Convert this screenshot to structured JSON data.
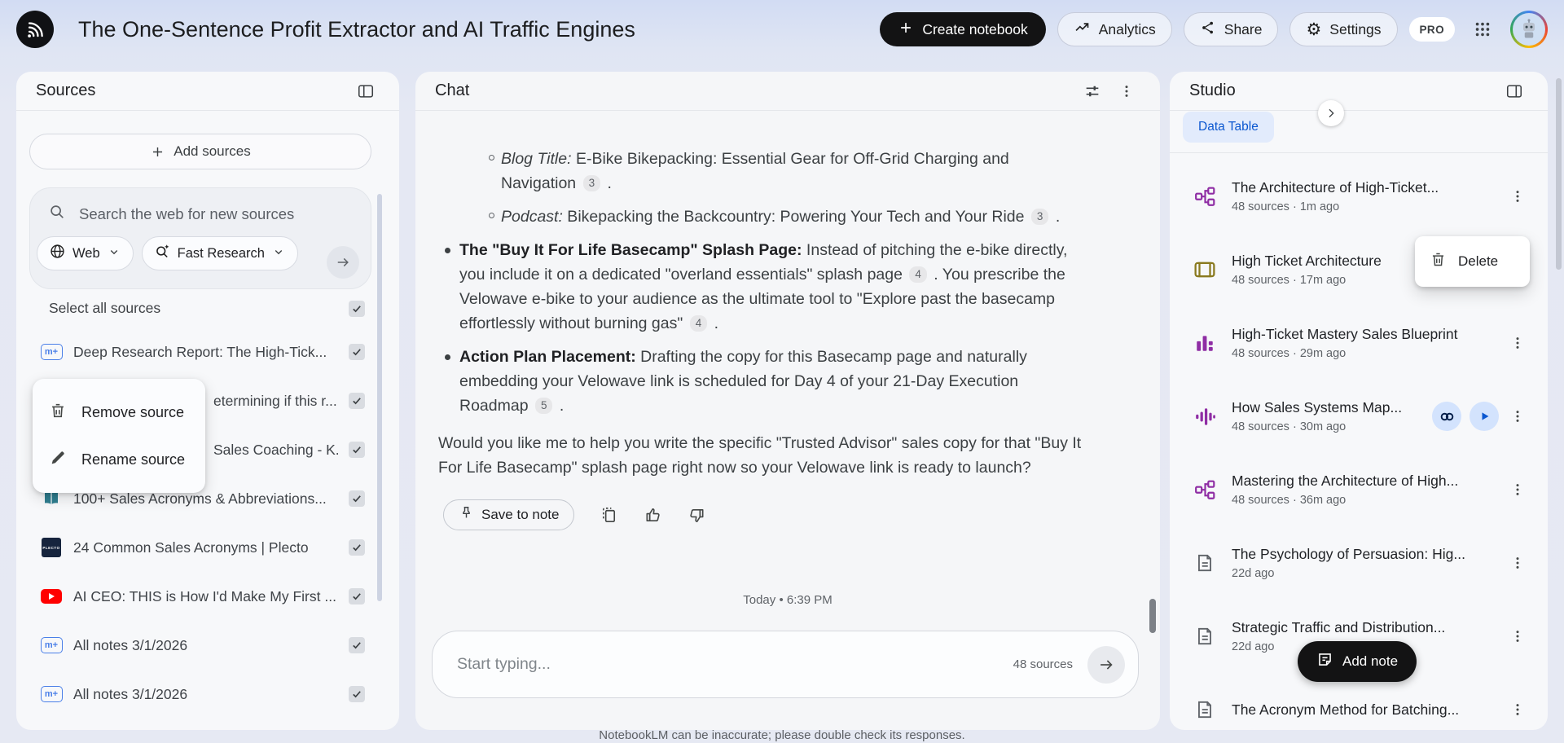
{
  "header": {
    "title": "The One-Sentence Profit Extractor and AI Traffic Engines",
    "create_label": "Create notebook",
    "analytics_label": "Analytics",
    "share_label": "Share",
    "settings_label": "Settings",
    "pro_label": "PRO"
  },
  "sources": {
    "title": "Sources",
    "add_label": "Add sources",
    "search_placeholder": "Search the web for new sources",
    "web_label": "Web",
    "fast_label": "Fast Research",
    "select_all": "Select all sources",
    "menu": {
      "remove": "Remove source",
      "rename": "Rename source"
    },
    "items": [
      {
        "icon": "markdown",
        "title": "Deep Research Report: The High-Tick...",
        "checked": true,
        "covered": false
      },
      {
        "icon": "",
        "title": "etermining if this r...",
        "checked": true,
        "covered": true
      },
      {
        "icon": "",
        "title": "Sales Coaching - K...",
        "checked": true,
        "covered": true
      },
      {
        "icon": "book",
        "title": "100+ Sales Acronyms & Abbreviations...",
        "checked": true,
        "covered": false
      },
      {
        "icon": "plecto",
        "title": "24 Common Sales Acronyms | Plecto",
        "checked": true,
        "covered": false
      },
      {
        "icon": "youtube",
        "title": "AI CEO: THIS is How I'd Make My First ...",
        "checked": true,
        "covered": false
      },
      {
        "icon": "markdown",
        "title": "All notes 3/1/2026",
        "checked": true,
        "covered": false
      },
      {
        "icon": "markdown",
        "title": "All notes 3/1/2026",
        "checked": true,
        "covered": false
      }
    ]
  },
  "chat": {
    "title": "Chat",
    "blocks": [
      {
        "type": "sub",
        "parts": [
          {
            "s": "i",
            "v": "Blog Title:"
          },
          {
            "s": "t",
            "v": " E-Bike Bikepacking: Essential Gear for Off-Grid Charging and Navigation "
          },
          {
            "s": "c",
            "v": "3"
          },
          {
            "s": "t",
            "v": " ."
          }
        ]
      },
      {
        "type": "sub",
        "parts": [
          {
            "s": "i",
            "v": "Podcast:"
          },
          {
            "s": "t",
            "v": " Bikepacking the Backcountry: Powering Your Tech and Your Ride "
          },
          {
            "s": "c",
            "v": "3"
          },
          {
            "s": "t",
            "v": " ."
          }
        ]
      },
      {
        "type": "bullet",
        "parts": [
          {
            "s": "b",
            "v": "The \"Buy It For Life Basecamp\" Splash Page:"
          },
          {
            "s": "t",
            "v": " Instead of pitching the e-bike directly, you include it on a dedicated \"overland essentials\" splash page "
          },
          {
            "s": "c",
            "v": "4"
          },
          {
            "s": "t",
            "v": " . You prescribe the Velowave e-bike to your audience as the ultimate tool to \"Explore past the basecamp effortlessly without burning gas\" "
          },
          {
            "s": "c",
            "v": "4"
          },
          {
            "s": "t",
            "v": " ."
          }
        ]
      },
      {
        "type": "bullet",
        "parts": [
          {
            "s": "b",
            "v": "Action Plan Placement:"
          },
          {
            "s": "t",
            "v": " Drafting the copy for this Basecamp page and naturally embedding your Velowave link is scheduled for Day 4 of your 21-Day Execution Roadmap "
          },
          {
            "s": "c",
            "v": "5"
          },
          {
            "s": "t",
            "v": " ."
          }
        ]
      },
      {
        "type": "para",
        "parts": [
          {
            "s": "t",
            "v": "Would you like me to help you write the specific \"Trusted Advisor\" sales copy for that \"Buy It For Life Basecamp\" splash page right now so your Velowave link is ready to launch?"
          }
        ]
      }
    ],
    "save_label": "Save to note",
    "timestamp": "Today • 6:39 PM",
    "input_placeholder": "Start typing...",
    "sources_count": "48 sources"
  },
  "studio": {
    "title": "Studio",
    "chip": "Data Table",
    "delete_label": "Delete",
    "add_note": "Add note",
    "items": [
      {
        "icon": "mindmap",
        "title": "The Architecture of High-Ticket...",
        "meta": "48 sources · 1m ago",
        "actions": [],
        "kebab": true
      },
      {
        "icon": "slides",
        "title": "High Ticket Architecture",
        "meta": "48 sources · 17m ago",
        "actions": [],
        "kebab": false
      },
      {
        "icon": "barchart",
        "title": "High-Ticket Mastery Sales Blueprint",
        "meta": "48 sources · 29m ago",
        "actions": [],
        "kebab": true
      },
      {
        "icon": "waveform",
        "title": "How Sales Systems Map...",
        "meta": "48 sources · 30m ago",
        "actions": [
          "interactive",
          "play"
        ],
        "kebab": true
      },
      {
        "icon": "mindmap",
        "title": "Mastering the Architecture of High...",
        "meta": "48 sources · 36m ago",
        "actions": [],
        "kebab": true
      },
      {
        "icon": "note",
        "title": "The Psychology of Persuasion: Hig...",
        "meta": "22d ago",
        "actions": [],
        "kebab": true
      },
      {
        "icon": "note",
        "title": "Strategic Traffic and Distribution...",
        "meta": "22d ago",
        "actions": [],
        "kebab": true
      },
      {
        "icon": "note",
        "title": "The Acronym Method for Batching...",
        "meta": "",
        "actions": [],
        "kebab": true
      }
    ]
  },
  "footer": {
    "disclaimer": "NotebookLM can be inaccurate; please double check its responses."
  },
  "colors": {
    "studio_purple": "#8f2da4",
    "studio_olive": "#8a7a1f",
    "accent_blue": "#0b57d0",
    "chip_blue_bg": "#e2ebfc",
    "source_icon_blue": "#4a7fe8",
    "youtube_red": "#ff0000",
    "black_button": "#131314"
  }
}
